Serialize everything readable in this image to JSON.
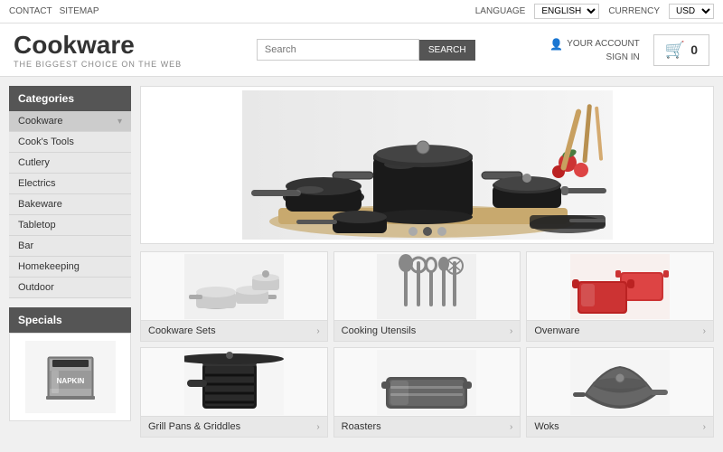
{
  "topbar": {
    "contact": "CONTACT",
    "sitemap": "SITEMAP",
    "language_label": "LANGUAGE",
    "language_value": "ENGLISH",
    "currency_label": "CURRENCY",
    "currency_value": "USD"
  },
  "header": {
    "logo_title": "Cookware",
    "logo_sub": "THE BIGGEST CHOICE ON THE WEB",
    "search_placeholder": "Search",
    "search_button": "SEARCH",
    "account_label": "YOUR ACCOUNT",
    "signin_label": "SIGN IN",
    "cart_count": "0"
  },
  "sidebar": {
    "categories_title": "Categories",
    "items": [
      {
        "label": "Cookware",
        "active": true,
        "has_arrow": true
      },
      {
        "label": "Cook's Tools",
        "active": false,
        "has_arrow": false
      },
      {
        "label": "Cutlery",
        "active": false,
        "has_arrow": false
      },
      {
        "label": "Electrics",
        "active": false,
        "has_arrow": false
      },
      {
        "label": "Bakeware",
        "active": false,
        "has_arrow": false
      },
      {
        "label": "Tabletop",
        "active": false,
        "has_arrow": false
      },
      {
        "label": "Bar",
        "active": false,
        "has_arrow": false
      },
      {
        "label": "Homekeeping",
        "active": false,
        "has_arrow": false
      },
      {
        "label": "Outdoor",
        "active": false,
        "has_arrow": false
      }
    ],
    "specials_title": "Specials"
  },
  "carousel": {
    "dots": [
      {
        "active": false
      },
      {
        "active": true
      },
      {
        "active": false
      }
    ]
  },
  "products_row1": [
    {
      "label": "Cookware Sets"
    },
    {
      "label": "Cooking Utensils"
    },
    {
      "label": "Ovenware"
    }
  ],
  "products_row2": [
    {
      "label": "Grill Pans & Griddles"
    },
    {
      "label": "Roasters"
    },
    {
      "label": "Woks"
    }
  ]
}
